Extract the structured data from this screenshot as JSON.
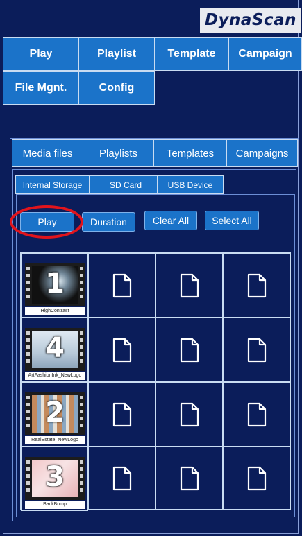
{
  "brand": {
    "logo_text": "DynaScan"
  },
  "main_nav": [
    "Play",
    "Playlist",
    "Template",
    "Campaign",
    "File Mgnt.",
    "Config"
  ],
  "category_tabs": [
    "Media files",
    "Playlists",
    "Templates",
    "Campaigns"
  ],
  "storage_tabs": [
    "Internal Storage",
    "SD Card",
    "USB Device"
  ],
  "actions": {
    "play": "Play",
    "duration": "Duration",
    "clear_all": "Clear All",
    "select_all": "Select All"
  },
  "media_items": [
    {
      "number": "1",
      "caption": "HighContrast"
    },
    {
      "number": "4",
      "caption": "ArtFashionInk_NewLogo"
    },
    {
      "number": "2",
      "caption": "RealEstate_NewLogo"
    },
    {
      "number": "3",
      "caption": "BackBump"
    }
  ],
  "colors": {
    "background": "#0b1d5a",
    "button": "#1b73c9",
    "highlight": "#e1141c",
    "logo_bg": "#e8eaf0"
  },
  "icons": {
    "empty_slot": "document-icon"
  }
}
